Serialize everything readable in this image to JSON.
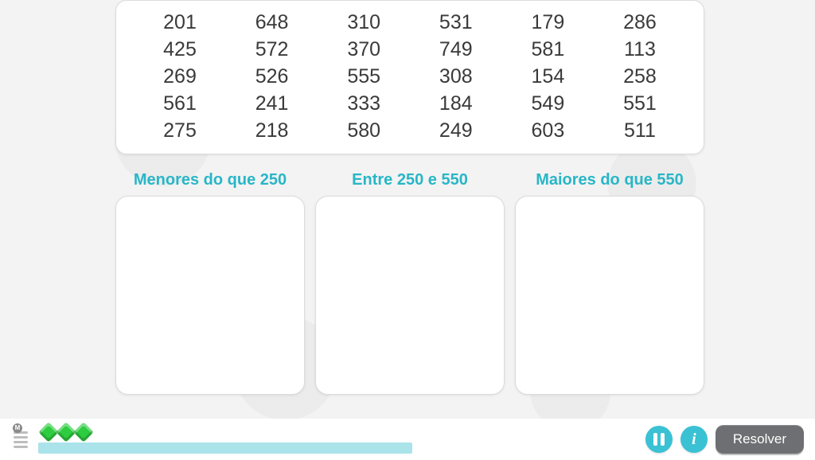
{
  "numbers": [
    [
      201,
      648,
      310,
      531,
      179,
      286
    ],
    [
      425,
      572,
      370,
      749,
      581,
      113
    ],
    [
      269,
      526,
      555,
      308,
      154,
      258
    ],
    [
      561,
      241,
      333,
      184,
      549,
      551
    ],
    [
      275,
      218,
      580,
      249,
      603,
      511
    ]
  ],
  "buckets": [
    {
      "label": "Menores do que 250"
    },
    {
      "label": "Entre 250 e 550"
    },
    {
      "label": "Maiores do que 550"
    }
  ],
  "footer": {
    "gems_count": 3,
    "resolve_label": "Resolver",
    "menu_badge": "M"
  },
  "colors": {
    "accent": "#28b6c7",
    "gem": "#2ecc40",
    "button": "#6d6f72"
  }
}
